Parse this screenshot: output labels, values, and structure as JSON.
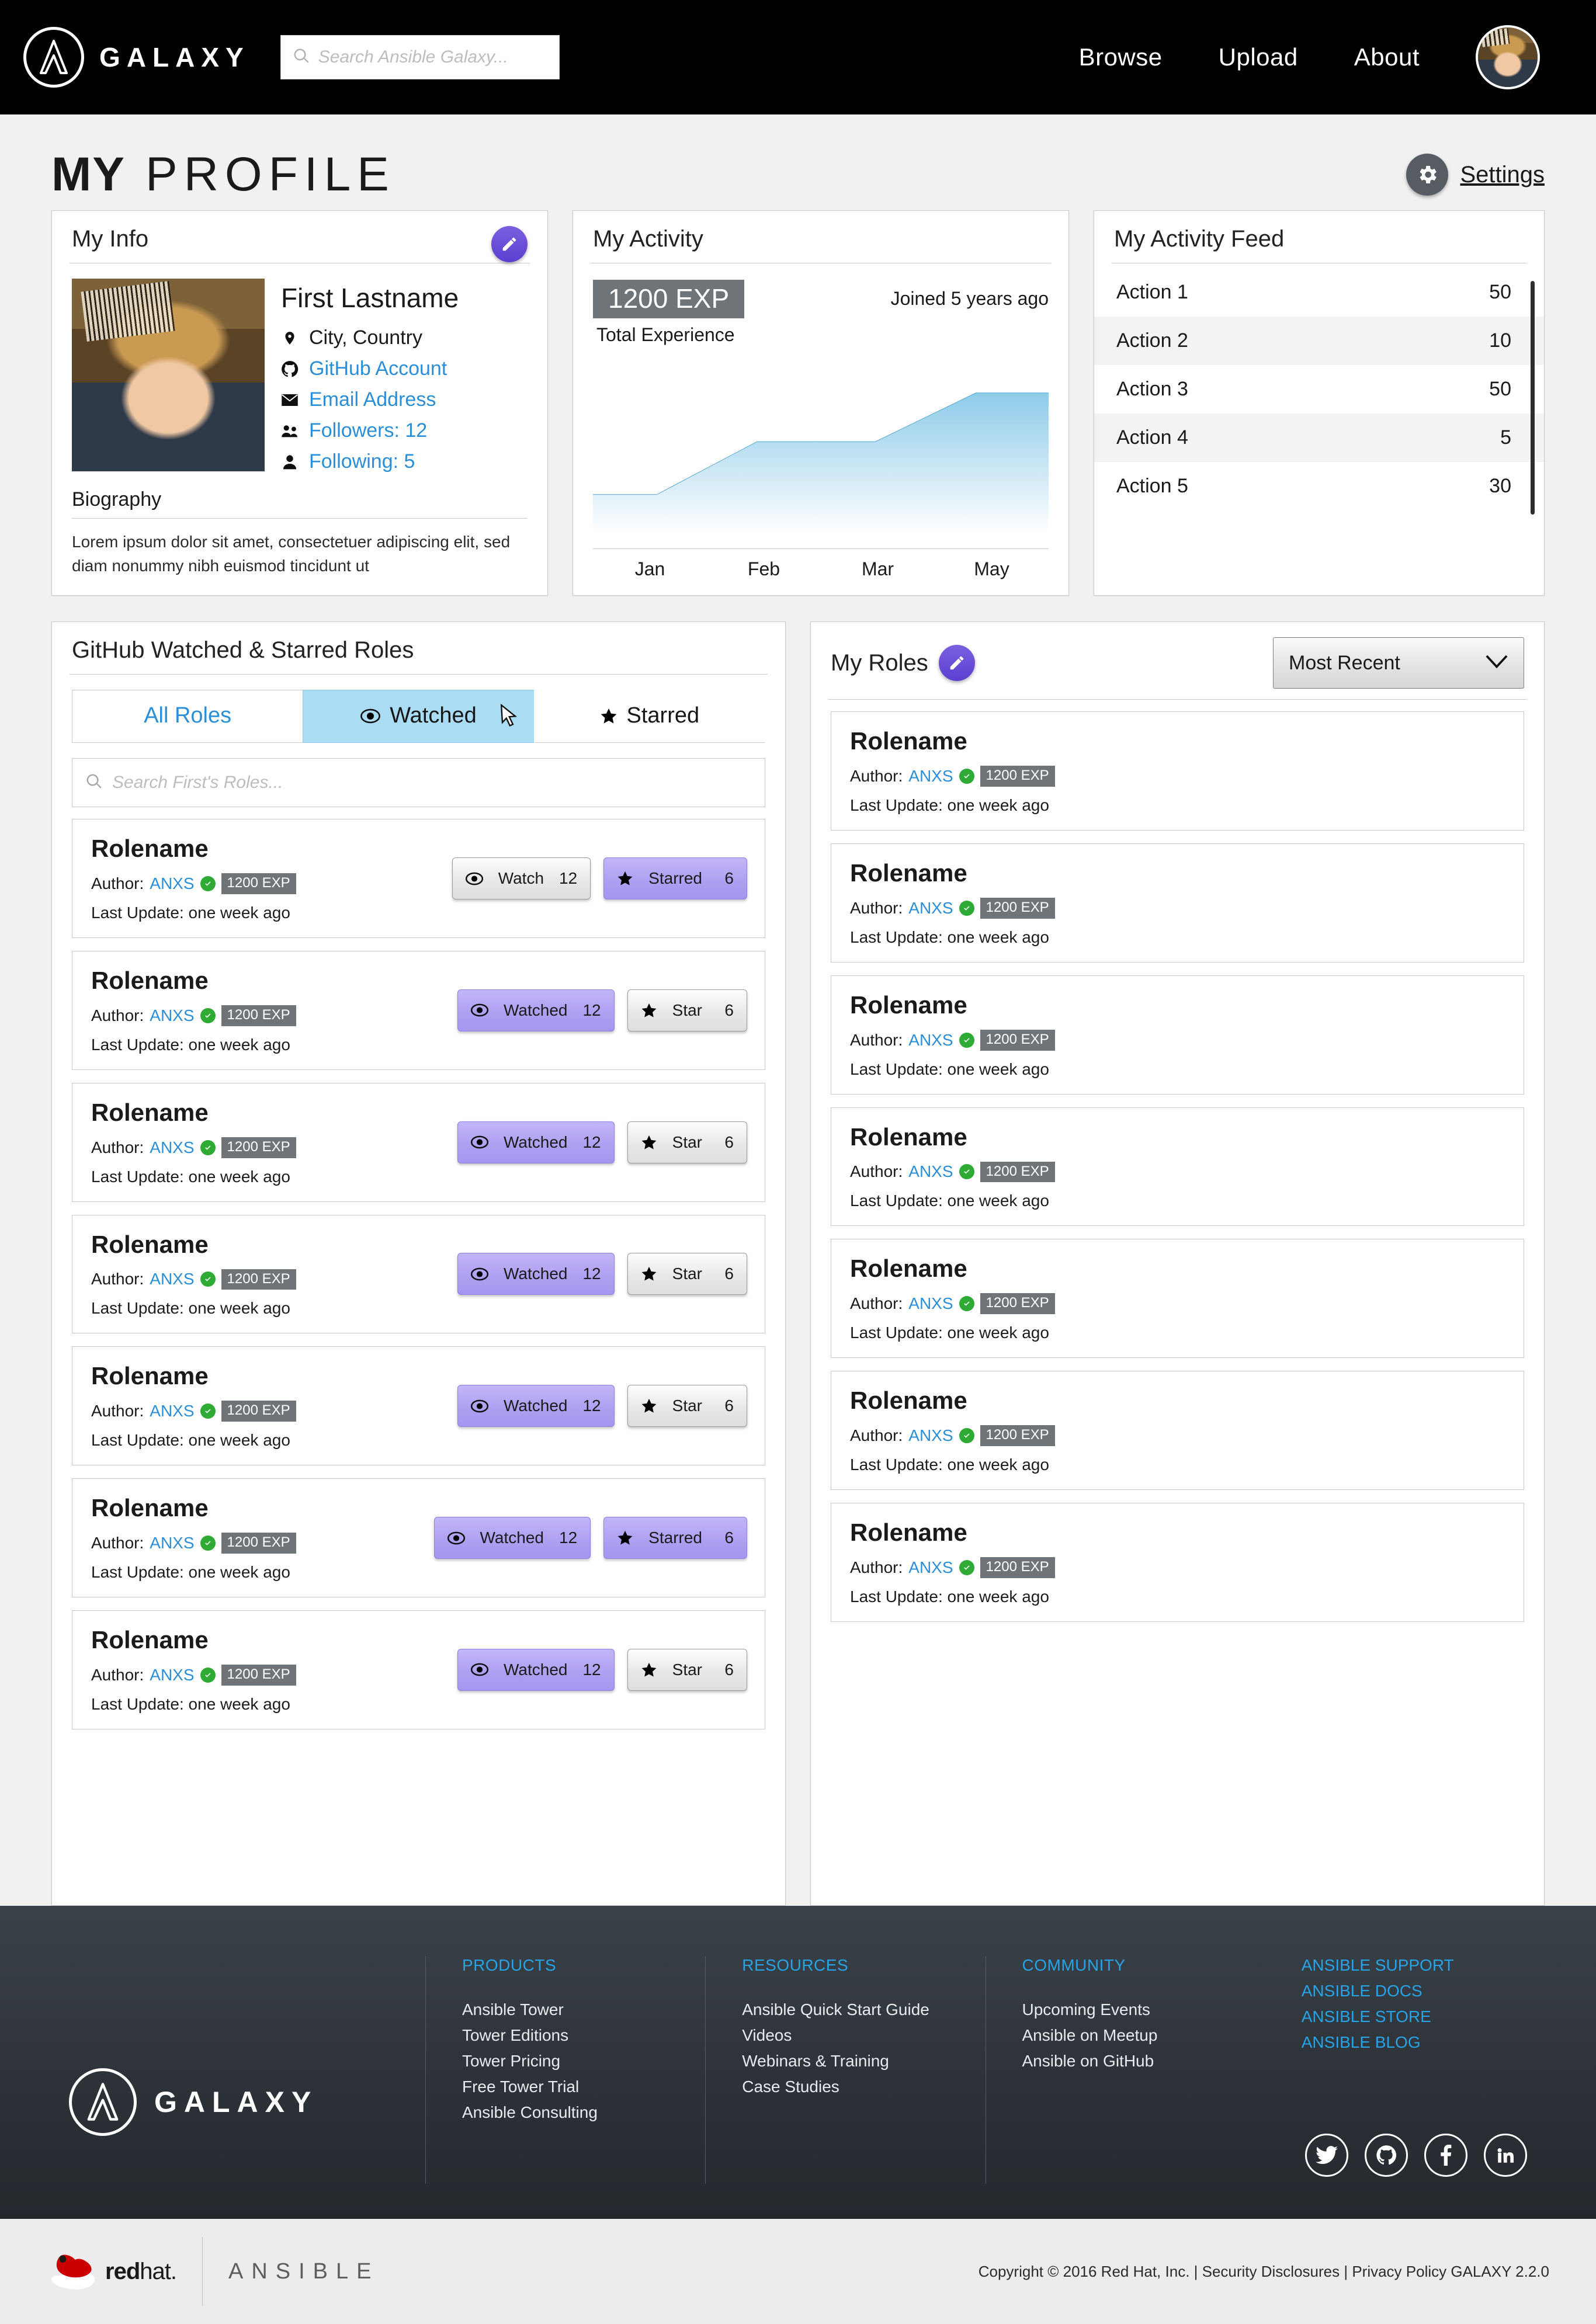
{
  "nav": {
    "brand": "GALAXY",
    "search_placeholder": "Search Ansible Galaxy...",
    "links": [
      {
        "label": "Browse"
      },
      {
        "label": "Upload"
      },
      {
        "label": "About"
      }
    ]
  },
  "page": {
    "title_bold": "MY",
    "title_light": "PROFILE",
    "settings_label": "Settings"
  },
  "my_info": {
    "title": "My Info",
    "name": "First Lastname",
    "meta": [
      {
        "icon": "location-pin-icon",
        "label": "City, Country",
        "link": false
      },
      {
        "icon": "github-icon",
        "label": "GitHub Account",
        "link": true
      },
      {
        "icon": "envelope-icon",
        "label": "Email Address",
        "link": true
      },
      {
        "icon": "users-icon",
        "label": "Followers: 12",
        "link": true
      },
      {
        "icon": "user-icon",
        "label": "Following: 5",
        "link": true
      }
    ],
    "biography_label": "Biography",
    "biography_text": "Lorem ipsum dolor sit amet, consectetuer adipiscing elit, sed diam nonummy nibh euismod tincidunt ut"
  },
  "my_activity": {
    "title": "My Activity",
    "exp_badge": "1200 EXP",
    "exp_sub": "Total Experience",
    "joined": "Joined 5 years ago"
  },
  "chart_data": {
    "type": "area",
    "title": "My Activity",
    "xlabel": "",
    "ylabel": "Total Experience",
    "categories": [
      "Jan",
      "Feb",
      "Mar",
      "May"
    ],
    "x_tick_labels": [
      "Jan",
      "Feb",
      "Mar",
      "May"
    ],
    "values": [
      300,
      300,
      700,
      700,
      1200,
      1200
    ],
    "x": [
      0,
      14,
      36,
      62,
      84,
      100
    ],
    "ylim": [
      0,
      1400
    ],
    "grid": false,
    "legend": null,
    "annotations": [
      "1200 EXP",
      "Total Experience",
      "Joined 5 years ago"
    ],
    "line_color": "#2b8fc6",
    "fill_top": "#9fd2ee",
    "fill_bottom": "#ffffff"
  },
  "activity_feed": {
    "title": "My Activity Feed",
    "items": [
      {
        "label": "Action 1",
        "value": "50"
      },
      {
        "label": "Action 2",
        "value": "10"
      },
      {
        "label": "Action 3",
        "value": "50"
      },
      {
        "label": "Action 4",
        "value": "5"
      },
      {
        "label": "Action 5",
        "value": "30"
      }
    ]
  },
  "github_roles": {
    "title": "GitHub Watched & Starred Roles",
    "tabs": [
      {
        "label": "All Roles",
        "icon": null,
        "active": false,
        "style": "link"
      },
      {
        "label": "Watched",
        "icon": "eye-icon",
        "active": true,
        "style": "plain"
      },
      {
        "label": "Starred",
        "icon": "star-icon",
        "active": false,
        "style": "plain"
      }
    ],
    "search_placeholder": "Search First's Roles...",
    "items": [
      {
        "name": "Rolename",
        "author_label": "Author:",
        "author": "ANXS",
        "exp": "1200 EXP",
        "updated": "Last Update: one week ago",
        "watch": {
          "label": "Watch",
          "count": "12",
          "on": false
        },
        "star": {
          "label": "Starred",
          "count": "6",
          "on": true
        }
      },
      {
        "name": "Rolename",
        "author_label": "Author:",
        "author": "ANXS",
        "exp": "1200 EXP",
        "updated": "Last Update: one week ago",
        "watch": {
          "label": "Watched",
          "count": "12",
          "on": true
        },
        "star": {
          "label": "Star",
          "count": "6",
          "on": false
        }
      },
      {
        "name": "Rolename",
        "author_label": "Author:",
        "author": "ANXS",
        "exp": "1200 EXP",
        "updated": "Last Update: one week ago",
        "watch": {
          "label": "Watched",
          "count": "12",
          "on": true
        },
        "star": {
          "label": "Star",
          "count": "6",
          "on": false
        }
      },
      {
        "name": "Rolename",
        "author_label": "Author:",
        "author": "ANXS",
        "exp": "1200 EXP",
        "updated": "Last Update: one week ago",
        "watch": {
          "label": "Watched",
          "count": "12",
          "on": true
        },
        "star": {
          "label": "Star",
          "count": "6",
          "on": false
        }
      },
      {
        "name": "Rolename",
        "author_label": "Author:",
        "author": "ANXS",
        "exp": "1200 EXP",
        "updated": "Last Update: one week ago",
        "watch": {
          "label": "Watched",
          "count": "12",
          "on": true
        },
        "star": {
          "label": "Star",
          "count": "6",
          "on": false
        }
      },
      {
        "name": "Rolename",
        "author_label": "Author:",
        "author": "ANXS",
        "exp": "1200 EXP",
        "updated": "Last Update: one week ago",
        "watch": {
          "label": "Watched",
          "count": "12",
          "on": true
        },
        "star": {
          "label": "Starred",
          "count": "6",
          "on": true
        }
      },
      {
        "name": "Rolename",
        "author_label": "Author:",
        "author": "ANXS",
        "exp": "1200 EXP",
        "updated": "Last Update: one week ago",
        "watch": {
          "label": "Watched",
          "count": "12",
          "on": true
        },
        "star": {
          "label": "Star",
          "count": "6",
          "on": false
        }
      }
    ]
  },
  "my_roles": {
    "title": "My Roles",
    "sort_selected": "Most Recent",
    "items": [
      {
        "name": "Rolename",
        "author_label": "Author:",
        "author": "ANXS",
        "exp": "1200 EXP",
        "updated": "Last Update: one week ago"
      },
      {
        "name": "Rolename",
        "author_label": "Author:",
        "author": "ANXS",
        "exp": "1200 EXP",
        "updated": "Last Update: one week ago"
      },
      {
        "name": "Rolename",
        "author_label": "Author:",
        "author": "ANXS",
        "exp": "1200 EXP",
        "updated": "Last Update: one week ago"
      },
      {
        "name": "Rolename",
        "author_label": "Author:",
        "author": "ANXS",
        "exp": "1200 EXP",
        "updated": "Last Update: one week ago"
      },
      {
        "name": "Rolename",
        "author_label": "Author:",
        "author": "ANXS",
        "exp": "1200 EXP",
        "updated": "Last Update: one week ago"
      },
      {
        "name": "Rolename",
        "author_label": "Author:",
        "author": "ANXS",
        "exp": "1200 EXP",
        "updated": "Last Update: one week ago"
      },
      {
        "name": "Rolename",
        "author_label": "Author:",
        "author": "ANXS",
        "exp": "1200 EXP",
        "updated": "Last Update: one week ago"
      }
    ]
  },
  "footer": {
    "brand": "GALAXY",
    "columns": [
      {
        "heading": "PRODUCTS",
        "links": [
          "Ansible Tower",
          "Tower Editions",
          "Tower Pricing",
          "Free Tower Trial",
          "Ansible Consulting"
        ],
        "blue": false
      },
      {
        "heading": "RESOURCES",
        "links": [
          "Ansible Quick Start Guide",
          "Videos",
          "Webinars & Training",
          "Case Studies"
        ],
        "blue": false
      },
      {
        "heading": "COMMUNITY",
        "links": [
          "Upcoming Events",
          "Ansible on Meetup",
          "Ansible on GitHub"
        ],
        "blue": false
      },
      {
        "heading": "",
        "links": [
          "ANSIBLE SUPPORT",
          "ANSIBLE DOCS",
          "ANSIBLE STORE",
          "ANSIBLE BLOG"
        ],
        "blue": true
      }
    ],
    "socials": [
      "twitter-icon",
      "github-icon",
      "facebook-icon",
      "linkedin-icon"
    ],
    "redhat_word": "redhat",
    "ansible_word": "ANSIBLE",
    "copyright": "Copyright © 2016 Red Hat, Inc. | Security Disclosures | Privacy Policy GALAXY 2.2.0"
  },
  "colors": {
    "accent_purple": "#6b4fd8",
    "link_blue": "#2a8fd8",
    "footer_blue": "#27a3e6",
    "chart_blue": "#2b8fc6",
    "badge_gray": "#6f7479",
    "tab_active": "#aadcf4",
    "verified_green": "#2faa35"
  }
}
